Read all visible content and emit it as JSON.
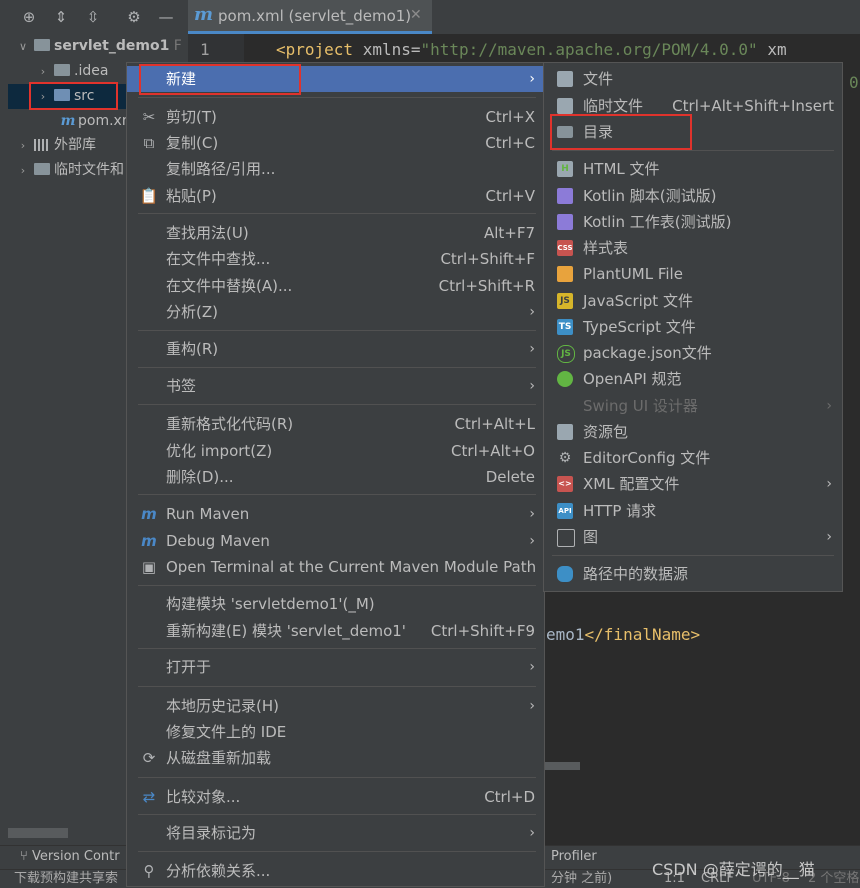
{
  "project_panel": {
    "tree": [
      {
        "label": "servlet_demo1",
        "suffix": "F",
        "expanded": true
      },
      {
        "label": ".idea"
      },
      {
        "label": "src",
        "selected": true
      },
      {
        "label": "pom.xml"
      },
      {
        "label": "外部库"
      },
      {
        "label": "临时文件和"
      }
    ]
  },
  "editor": {
    "tab_label": "pom.xml (servlet_demo1)",
    "line1_number": "1",
    "line1_tag": "<project",
    "line1_attr": "xmlns",
    "line1_eq": "=",
    "line1_value": "\"http://maven.apache.org/POM/4.0.0\"",
    "line1_more": "xm",
    "line2_fragment": "0",
    "final_name_text": "emo1",
    "final_name_close": "</finalName>"
  },
  "context_menu": {
    "items": [
      {
        "label": "新建",
        "has_submenu": true,
        "highlighted": true
      },
      {
        "icon": "scissors-icon",
        "label": "剪切(T)",
        "shortcut": "Ctrl+X"
      },
      {
        "icon": "copy-icon",
        "label": "复制(C)",
        "shortcut": "Ctrl+C"
      },
      {
        "label": "复制路径/引用..."
      },
      {
        "icon": "paste-icon",
        "label": "粘贴(P)",
        "shortcut": "Ctrl+V"
      },
      {
        "label": "查找用法(U)",
        "shortcut": "Alt+F7"
      },
      {
        "label": "在文件中查找...",
        "shortcut": "Ctrl+Shift+F"
      },
      {
        "label": "在文件中替换(A)...",
        "shortcut": "Ctrl+Shift+R"
      },
      {
        "label": "分析(Z)",
        "has_submenu": true
      },
      {
        "label": "重构(R)",
        "has_submenu": true
      },
      {
        "label": "书签",
        "has_submenu": true
      },
      {
        "label": "重新格式化代码(R)",
        "shortcut": "Ctrl+Alt+L"
      },
      {
        "label": "优化 import(Z)",
        "shortcut": "Ctrl+Alt+O"
      },
      {
        "label": "删除(D)...",
        "shortcut": "Delete"
      },
      {
        "icon": "run-maven-icon",
        "label": "Run Maven",
        "has_submenu": true
      },
      {
        "icon": "debug-maven-icon",
        "label": "Debug Maven",
        "has_submenu": true
      },
      {
        "icon": "terminal-icon",
        "label": "Open Terminal at the Current Maven Module Path"
      },
      {
        "label": "构建模块 'servletdemo1'(_M)"
      },
      {
        "label": "重新构建(E) 模块 'servlet_demo1'",
        "shortcut": "Ctrl+Shift+F9"
      },
      {
        "label": "打开于",
        "has_submenu": true
      },
      {
        "label": "本地历史记录(H)",
        "has_submenu": true
      },
      {
        "label": "修复文件上的 IDE"
      },
      {
        "icon": "reload-icon",
        "label": "从磁盘重新加载"
      },
      {
        "icon": "compare-icon",
        "label": "比较对象...",
        "shortcut": "Ctrl+D"
      },
      {
        "label": "将目录标记为",
        "has_submenu": true
      },
      {
        "icon": "dependency-icon",
        "label": "分析依赖关系..."
      }
    ]
  },
  "new_submenu": {
    "items": [
      {
        "label": "文件"
      },
      {
        "label": "临时文件",
        "shortcut": "Ctrl+Alt+Shift+Insert"
      },
      {
        "label": "目录"
      },
      {
        "label": "HTML 文件",
        "badge": "H"
      },
      {
        "label": "Kotlin 脚本(测试版)"
      },
      {
        "label": "Kotlin 工作表(测试版)"
      },
      {
        "label": "样式表",
        "badge": "CSS"
      },
      {
        "label": "PlantUML File"
      },
      {
        "label": "JavaScript 文件",
        "badge": "JS"
      },
      {
        "label": "TypeScript 文件",
        "badge": "TS"
      },
      {
        "label": "package.json文件"
      },
      {
        "label": "OpenAPI 规范"
      },
      {
        "label": "Swing UI 设计器",
        "disabled": true
      },
      {
        "label": "资源包"
      },
      {
        "label": "EditorConfig 文件"
      },
      {
        "label": "XML 配置文件",
        "badge": "<>"
      },
      {
        "label": "HTTP 请求",
        "badge": "API"
      },
      {
        "label": "图"
      },
      {
        "label": "路径中的数据源"
      }
    ]
  },
  "bottom": {
    "version_control": "Version Contr",
    "profiler": "Profiler",
    "status_left": "下载预构建共享索",
    "status_ago": "分钟 之前)",
    "position": "1:1",
    "line_ending": "CRLF",
    "encoding": "UTF-8",
    "indent": "2 个空格",
    "watermark": "CSDN @薛定谔的__猫"
  },
  "colors": {
    "highlight": "#4b6eaf",
    "annotation_red": "#e0332c",
    "menu_bg": "#3c3f41"
  }
}
